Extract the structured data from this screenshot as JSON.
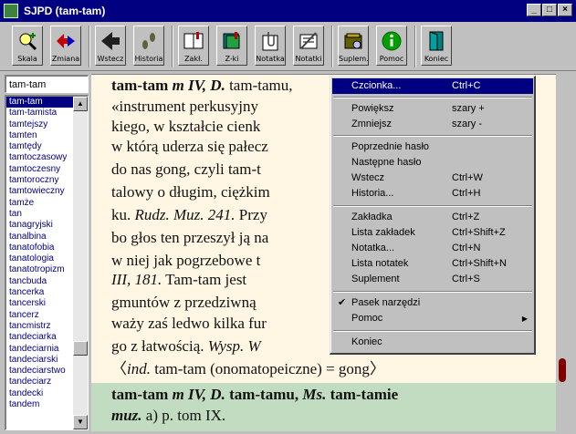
{
  "window": {
    "title": "SJPD  (tam-tam)"
  },
  "toolbar": {
    "buttons": [
      {
        "label": "Skala",
        "icon": "magnifier-plus-icon"
      },
      {
        "label": "Zmiana",
        "icon": "swap-arrows-icon"
      },
      {
        "label": "Wstecz",
        "icon": "back-arrow-icon"
      },
      {
        "label": "Historia",
        "icon": "footprints-icon"
      },
      {
        "label": "Zakł.",
        "icon": "book-bookmark-icon"
      },
      {
        "label": "Z-ki",
        "icon": "bookmarks-list-icon"
      },
      {
        "label": "Notatka",
        "icon": "paperclip-note-icon"
      },
      {
        "label": "Notatki",
        "icon": "notes-list-icon"
      },
      {
        "label": "Suplem.",
        "icon": "supplement-book-icon"
      },
      {
        "label": "Pomoc",
        "icon": "info-icon"
      },
      {
        "label": "Koniec",
        "icon": "exit-door-icon"
      }
    ]
  },
  "search": {
    "value": "tam-tam"
  },
  "list": {
    "items": [
      "tam-tam",
      "tam-tamista",
      "tamtejszy",
      "tamten",
      "tamtędy",
      "tamtoczasowy",
      "tamtoczesny",
      "tamtoroczny",
      "tamtowieczny",
      "tamże",
      "tan",
      "tanagryjski",
      "tanalbina",
      "tanatofobia",
      "tanatologia",
      "tanatotropizm",
      "tancbuda",
      "tancerka",
      "tancerski",
      "tancerz",
      "tancmistrz",
      "tandeciarka",
      "tandeciarnia",
      "tandeciarski",
      "tandeciarstwo",
      "tandeciarz",
      "tandecki",
      "tandem"
    ],
    "selected": "tam-tam"
  },
  "entry": {
    "lines": [
      [
        "tam-tam ",
        "m IV, D.",
        " tam-tamu, "
      ],
      [
        "«instrument perkusyjny "
      ],
      [
        "kiego, w kształcie cienk"
      ],
      [
        "w którą uderza się pałecz"
      ],
      [
        "do nas gong, czyli tam-t"
      ],
      [
        "talowy o długim, ciężkim"
      ],
      [
        "ku. ",
        "Rudz. Muz. 241.",
        " Przy"
      ],
      [
        "bo głos ten przeszył ją na"
      ],
      [
        "w niej jak pogrzebowe t"
      ],
      [
        "III, 181.",
        " Tam-tam jest "
      ],
      [
        "gmuntów z przedziwną"
      ],
      [
        "waży zaś ledwo kilka fur"
      ],
      [
        "go z łatwością. ",
        "Wysp. W"
      ],
      [
        "〈",
        "ind.",
        " tam-tam (onomatopeiczne) = gong〉"
      ]
    ],
    "second": [
      [
        "tam-tam ",
        "m IV, D.",
        " tam-tamu, ",
        "Ms.",
        " tam-tamie"
      ],
      [
        "muz.",
        " a) p. tom IX."
      ]
    ]
  },
  "context_menu": {
    "items": [
      {
        "label": "Czcionka...",
        "shortcut": "Ctrl+C",
        "highlighted": true
      },
      {
        "label": "Powiększ",
        "shortcut": "szary +"
      },
      {
        "label": "Zmniejsz",
        "shortcut": "szary -"
      },
      {
        "label": "Poprzednie hasło",
        "shortcut": ""
      },
      {
        "label": "Następne hasło",
        "shortcut": ""
      },
      {
        "label": "Wstecz",
        "shortcut": "Ctrl+W"
      },
      {
        "label": "Historia...",
        "shortcut": "Ctrl+H"
      },
      {
        "label": "Zakładka",
        "shortcut": "Ctrl+Z"
      },
      {
        "label": "Lista zakładek",
        "shortcut": "Ctrl+Shift+Z"
      },
      {
        "label": "Notatka...",
        "shortcut": "Ctrl+N"
      },
      {
        "label": "Lista notatek",
        "shortcut": "Ctrl+Shift+N"
      },
      {
        "label": "Suplement",
        "shortcut": "Ctrl+S"
      },
      {
        "label": "Pasek narzędzi",
        "shortcut": "",
        "checked": true
      },
      {
        "label": "Pomoc",
        "shortcut": "",
        "submenu": true
      },
      {
        "label": "Koniec",
        "shortcut": ""
      }
    ]
  },
  "colors": {
    "titlebar": "#000080",
    "entry_bg": "#fff7e4",
    "entry2_bg": "#c2dcc2",
    "selection": "#000080"
  }
}
